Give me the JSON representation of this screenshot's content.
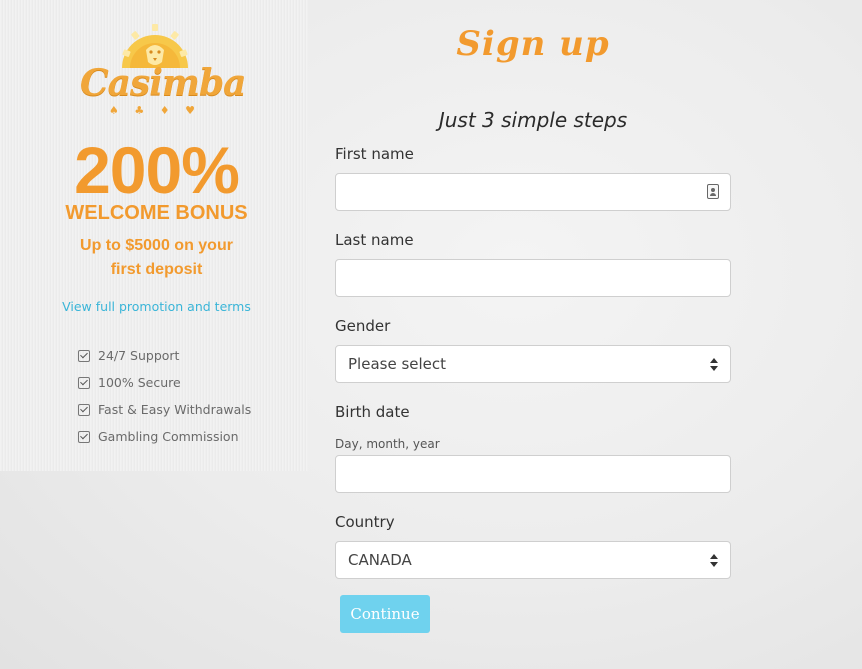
{
  "brand": {
    "logo_text": "Casimba",
    "logo_suits": "♠ ♣ ♦ ♥",
    "accent_color": "#f29a2e",
    "link_color": "#3ab5d8",
    "button_color": "#6fd2ee"
  },
  "promo": {
    "headline": "200%",
    "subheadline": "WELCOME BONUS",
    "detail": "Up to $5000 on your first deposit",
    "link_text": "View full promotion and terms",
    "features": [
      "24/7 Support",
      "100% Secure",
      "Fast & Easy Withdrawals",
      "Gambling Commission"
    ]
  },
  "form": {
    "title": "Sign up",
    "subtitle": "Just 3 simple steps",
    "first_name": {
      "label": "First name",
      "value": ""
    },
    "last_name": {
      "label": "Last name",
      "value": ""
    },
    "gender": {
      "label": "Gender",
      "selected": "Please select"
    },
    "birth_date": {
      "label": "Birth date",
      "hint": "Day, month, year",
      "value": ""
    },
    "country": {
      "label": "Country",
      "selected": "CANADA"
    },
    "continue_label": "Continue"
  }
}
